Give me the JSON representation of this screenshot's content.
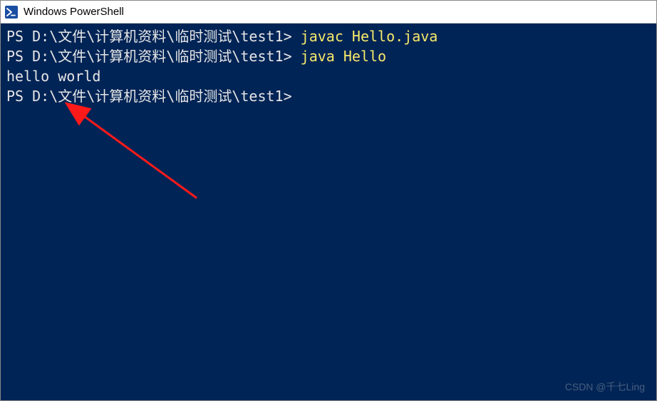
{
  "window": {
    "title": "Windows PowerShell"
  },
  "terminal": {
    "lines": [
      {
        "prompt": "PS D:\\文件\\计算机资料\\临时测试\\test1> ",
        "command": "javac Hello.java"
      },
      {
        "prompt": "PS D:\\文件\\计算机资料\\临时测试\\test1> ",
        "command": "java Hello"
      },
      {
        "output": "hello world"
      },
      {
        "prompt": "PS D:\\文件\\计算机资料\\临时测试\\test1>"
      }
    ]
  },
  "watermark": "CSDN @千七Ling"
}
